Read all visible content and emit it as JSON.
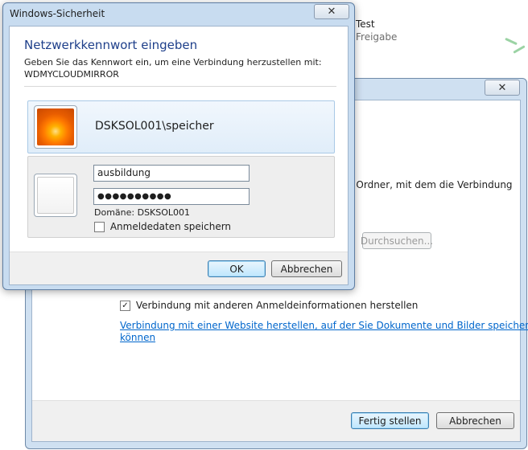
{
  "background": {
    "share": {
      "name": "Test",
      "subtitle": "Freigabe"
    },
    "dialog": {
      "close_glyph": "✕",
      "folder_text": "n Ordner, mit dem die Verbindung",
      "browse_label": "Durchsuchen...",
      "other_credentials_checked": true,
      "other_credentials_label": "Verbindung mit anderen Anmeldeinformationen herstellen",
      "website_link_line1": "Verbindung mit einer Website herstellen, auf der Sie Dokumente und Bilder speichern",
      "website_link_line2": "können",
      "finish_label": "Fertig stellen",
      "cancel_label": "Abbrechen"
    }
  },
  "credential_dialog": {
    "title": "Windows-Sicherheit",
    "close_glyph": "✕",
    "heading": "Netzwerkkennwort eingeben",
    "description_line1": "Geben Sie das Kennwort ein, um eine Verbindung herzustellen mit:",
    "description_line2": "WDMYCLOUDMIRROR",
    "saved_user": "DSKSOL001\\speicher",
    "username_value": "ausbildung",
    "password_value": "●●●●●●●●●●",
    "domain_text": "Domäne: DSKSOL001",
    "remember_label": "Anmeldedaten speichern",
    "remember_checked": false,
    "ok_label": "OK",
    "cancel_label": "Abbrechen"
  },
  "colors": {
    "heading": "#1e3f8a",
    "link": "#0066cc",
    "window_frame": "#c8dcf0"
  }
}
